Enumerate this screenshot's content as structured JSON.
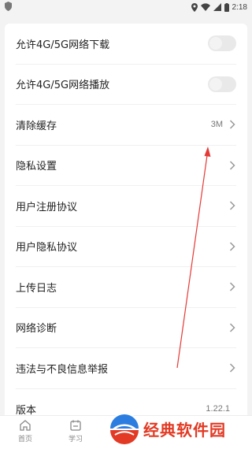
{
  "status_bar": {
    "time": "2:18"
  },
  "settings": {
    "items": [
      {
        "label": "允许4G/5G网络下载",
        "type": "toggle",
        "on": false
      },
      {
        "label": "允许4G/5G网络播放",
        "type": "toggle",
        "on": false
      },
      {
        "label": "清除缓存",
        "type": "link",
        "value": "3M"
      },
      {
        "label": "隐私设置",
        "type": "link",
        "value": ""
      },
      {
        "label": "用户注册协议",
        "type": "link",
        "value": ""
      },
      {
        "label": "用户隐私协议",
        "type": "link",
        "value": ""
      },
      {
        "label": "上传日志",
        "type": "link",
        "value": ""
      },
      {
        "label": "网络诊断",
        "type": "link",
        "value": ""
      },
      {
        "label": "违法与不良信息举报",
        "type": "link",
        "value": ""
      },
      {
        "label": "版本",
        "type": "info",
        "value": "1.22.1"
      }
    ]
  },
  "bottom_nav": {
    "home_label": "首页",
    "study_label": "学习"
  },
  "watermark": {
    "text": "经典软件园"
  },
  "colors": {
    "accent_red": "#e23a24",
    "toggle_off": "#e9e9e9",
    "background": "#f3f3f3"
  }
}
